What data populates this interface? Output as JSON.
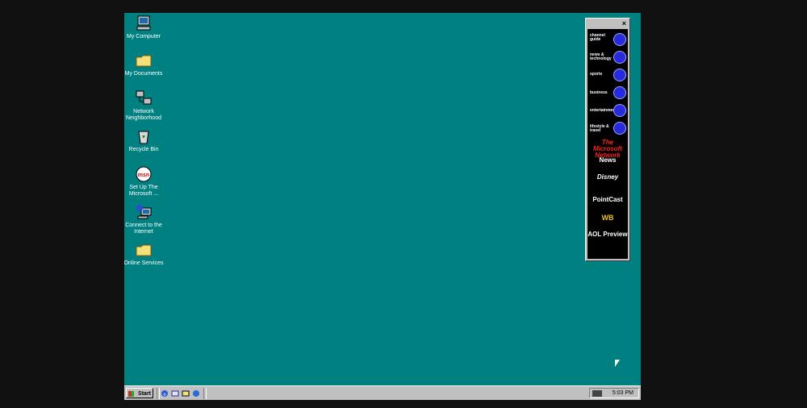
{
  "desktop": {
    "icons": [
      {
        "label": "My Computer",
        "icon": "computer-icon"
      },
      {
        "label": "My Documents",
        "icon": "folder-icon"
      },
      {
        "label": "Network Neighborhood",
        "icon": "network-icon"
      },
      {
        "label": "Recycle Bin",
        "icon": "recycle-bin-icon"
      },
      {
        "label": "Set Up The Microsoft ...",
        "icon": "msn-icon"
      },
      {
        "label": "Connect to the Internet",
        "icon": "connect-internet-icon"
      },
      {
        "label": "Online Services",
        "icon": "folder-icon"
      }
    ],
    "background_color": "#008080"
  },
  "channel_bar": {
    "close_glyph": "×",
    "channels": [
      {
        "label": "channel guide"
      },
      {
        "label": "news & technology"
      },
      {
        "label": "sports"
      },
      {
        "label": "business"
      },
      {
        "label": "entertainment"
      },
      {
        "label": "lifestyle & travel"
      }
    ],
    "brands": [
      "The Microsoft Network",
      "News",
      "Disney",
      "PointCast",
      "WB",
      "AOL Preview"
    ]
  },
  "taskbar": {
    "start_label": "Start",
    "clock": "5:03 PM"
  }
}
